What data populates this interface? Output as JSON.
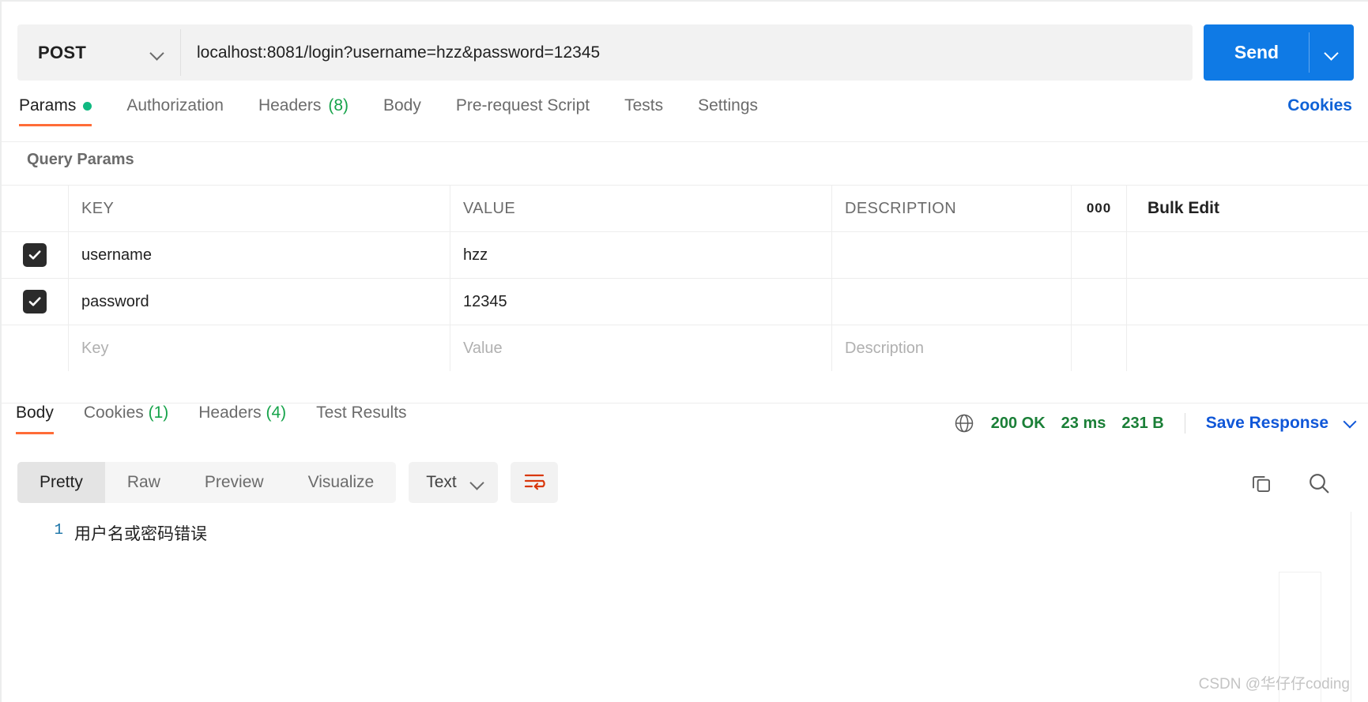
{
  "request": {
    "method": "POST",
    "url": "localhost:8081/login?username=hzz&password=12345",
    "send_label": "Send",
    "tabs": [
      {
        "label": "Params",
        "badge": "",
        "has_dot": true,
        "active": true
      },
      {
        "label": "Authorization",
        "badge": "",
        "has_dot": false,
        "active": false
      },
      {
        "label": "Headers",
        "badge": "(8)",
        "has_dot": false,
        "active": false
      },
      {
        "label": "Body",
        "badge": "",
        "has_dot": false,
        "active": false
      },
      {
        "label": "Pre-request Script",
        "badge": "",
        "has_dot": false,
        "active": false
      },
      {
        "label": "Tests",
        "badge": "",
        "has_dot": false,
        "active": false
      },
      {
        "label": "Settings",
        "badge": "",
        "has_dot": false,
        "active": false
      }
    ],
    "cookies_link": "Cookies"
  },
  "query_params": {
    "section_title": "Query Params",
    "columns": [
      "KEY",
      "VALUE",
      "DESCRIPTION"
    ],
    "dots_label": "000",
    "bulk_edit_label": "Bulk Edit",
    "rows": [
      {
        "checked": true,
        "key": "username",
        "value": "hzz",
        "description": ""
      },
      {
        "checked": true,
        "key": "password",
        "value": "12345",
        "description": ""
      }
    ],
    "placeholder_row": {
      "key": "Key",
      "value": "Value",
      "description": "Description"
    }
  },
  "response": {
    "tabs": [
      {
        "label": "Body",
        "badge": "",
        "active": true
      },
      {
        "label": "Cookies",
        "badge": "(1)",
        "active": false
      },
      {
        "label": "Headers",
        "badge": "(4)",
        "active": false
      },
      {
        "label": "Test Results",
        "badge": "",
        "active": false
      }
    ],
    "status": "200 OK",
    "time": "23 ms",
    "size": "231 B",
    "save_response_label": "Save Response",
    "view_modes": [
      {
        "label": "Pretty",
        "active": true
      },
      {
        "label": "Raw",
        "active": false
      },
      {
        "label": "Preview",
        "active": false
      },
      {
        "label": "Visualize",
        "active": false
      }
    ],
    "format": "Text",
    "body_lines": [
      {
        "number": "1",
        "text": "用户名或密码错误"
      }
    ]
  },
  "watermark": "CSDN @华仔仔coding",
  "colors": {
    "accent_orange": "#ff6c37",
    "send_blue": "#0f7ae5",
    "link_blue": "#1057d8",
    "status_green": "#1a7f37",
    "dot_green": "#10b981"
  }
}
